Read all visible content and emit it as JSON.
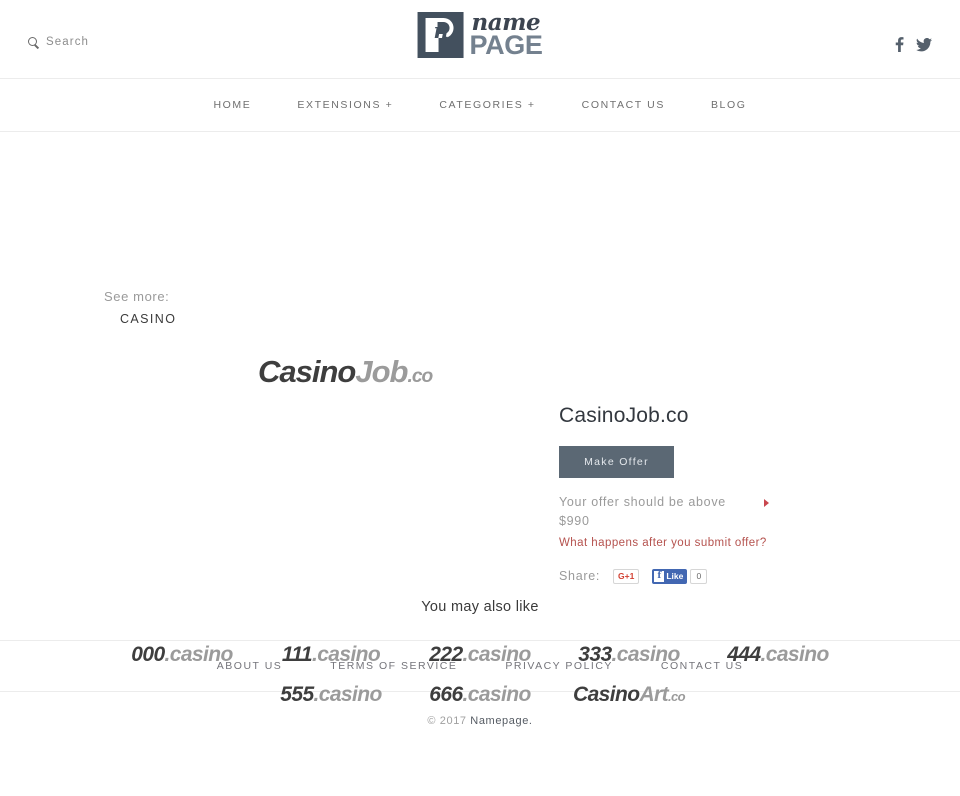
{
  "header": {
    "search_label": "Search",
    "search_icon": "search-icon",
    "logo": {
      "mark_letter": "n",
      "name_text": "name",
      "page_text": "PAGE"
    },
    "socials": [
      {
        "name": "facebook-icon",
        "label": "f"
      },
      {
        "name": "twitter-icon",
        "label": "t"
      }
    ]
  },
  "nav": {
    "items": [
      {
        "label": "HOME"
      },
      {
        "label": "EXTENSIONS +"
      },
      {
        "label": "CATEGORIES +"
      },
      {
        "label": "CONTACT US"
      },
      {
        "label": "BLOG"
      }
    ]
  },
  "see_more": {
    "label": "See more:",
    "category": "CASINO"
  },
  "hero": {
    "domain_dark": "Casino",
    "domain_light": "Job",
    "domain_ext": ".co"
  },
  "offer": {
    "title": "CasinoJob.co",
    "button_label": "Make Offer",
    "note": "Your offer should be above",
    "price": "$990",
    "link": "What happens after you submit offer?",
    "arrow_icon": "arrow-right-icon",
    "share_label": "Share:",
    "gplus_label": "G+1",
    "facebook_like_label": "Like",
    "facebook_count": "0"
  },
  "also_like": {
    "title": "You may also like",
    "row1": [
      {
        "dark": "000",
        "light": ".casino",
        "ext": ""
      },
      {
        "dark": "111",
        "light": ".casino",
        "ext": ""
      },
      {
        "dark": "222",
        "light": ".casino",
        "ext": ""
      },
      {
        "dark": "333",
        "light": ".casino",
        "ext": ""
      },
      {
        "dark": "444",
        "light": ".casino",
        "ext": ""
      }
    ],
    "row2": [
      {
        "dark": "555",
        "light": ".casino",
        "ext": ""
      },
      {
        "dark": "666",
        "light": ".casino",
        "ext": ""
      },
      {
        "dark": "Casino",
        "light": "Art",
        "ext": ".co"
      }
    ]
  },
  "footer": {
    "links": [
      {
        "label": "ABOUT US"
      },
      {
        "label": "TERMS OF SERVICE"
      },
      {
        "label": "PRIVACY POLICY"
      },
      {
        "label": "CONTACT US"
      }
    ],
    "copyright_prefix": "© 2017 ",
    "copyright_brand": "Namepage."
  },
  "colors": {
    "button_bg": "#5b6874",
    "link_red": "#b5524e",
    "arrow_red": "#c9474f",
    "facebook_blue": "#4267b2",
    "gplus_red": "#d23f31",
    "logo_dark": "#43505e",
    "logo_light": "#74818f"
  }
}
